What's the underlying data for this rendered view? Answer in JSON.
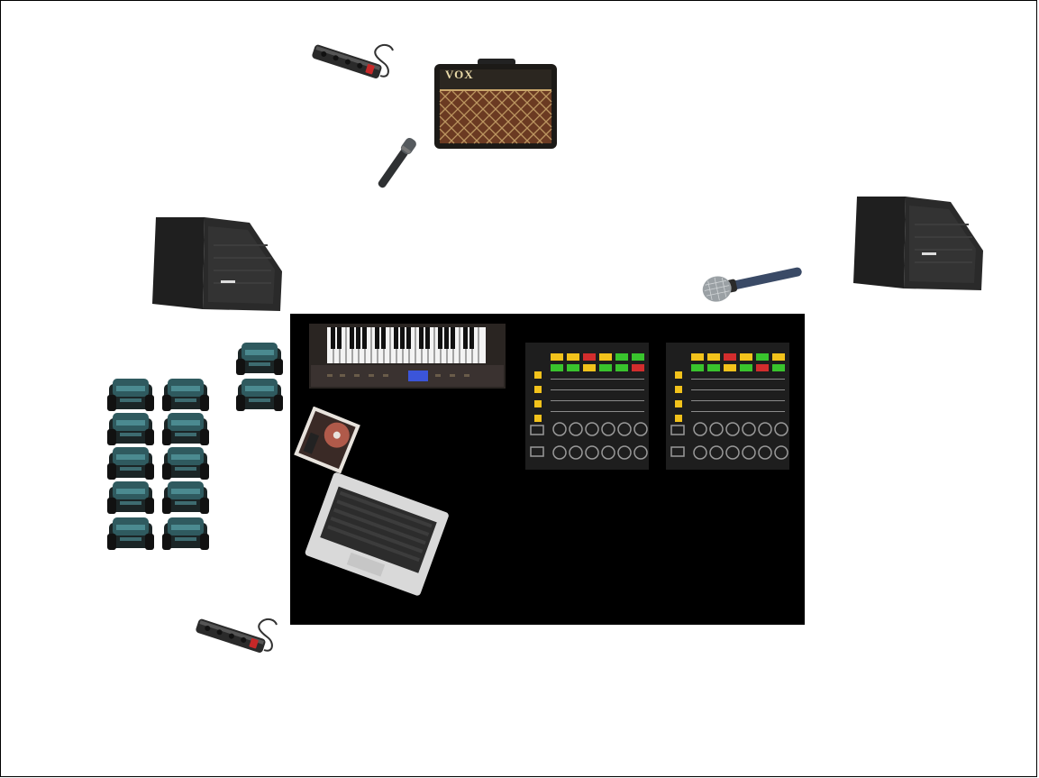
{
  "colors": {
    "background": "#ffffff",
    "stage": "#000000",
    "di_box": "#2f5a5f",
    "di_box_dark": "#1b2526",
    "meter_yellow": "#f2c21b",
    "meter_red": "#d22d2d",
    "meter_green": "#39c42d"
  },
  "amplifier": {
    "brand": "VOX",
    "icon": "guitar-amplifier-icon"
  },
  "items": [
    {
      "name": "power-strip-top",
      "icon": "power-strip-icon"
    },
    {
      "name": "guitar-amp",
      "icon": "guitar-amplifier-icon"
    },
    {
      "name": "instrument-microphone",
      "icon": "microphone-icon"
    },
    {
      "name": "monitor-wedge-left",
      "icon": "stage-monitor-icon"
    },
    {
      "name": "monitor-wedge-right",
      "icon": "stage-monitor-icon"
    },
    {
      "name": "vocal-microphone",
      "icon": "microphone-icon"
    },
    {
      "name": "di-box-group",
      "icon": "di-box-icon",
      "count": 12
    },
    {
      "name": "midi-keyboard",
      "icon": "keyboard-icon"
    },
    {
      "name": "audio-interface-cd",
      "icon": "cd-interface-icon"
    },
    {
      "name": "laptop",
      "icon": "laptop-icon"
    },
    {
      "name": "mixer-left",
      "icon": "mixer-icon"
    },
    {
      "name": "mixer-right",
      "icon": "mixer-icon"
    },
    {
      "name": "power-strip-bottom",
      "icon": "power-strip-icon"
    }
  ]
}
